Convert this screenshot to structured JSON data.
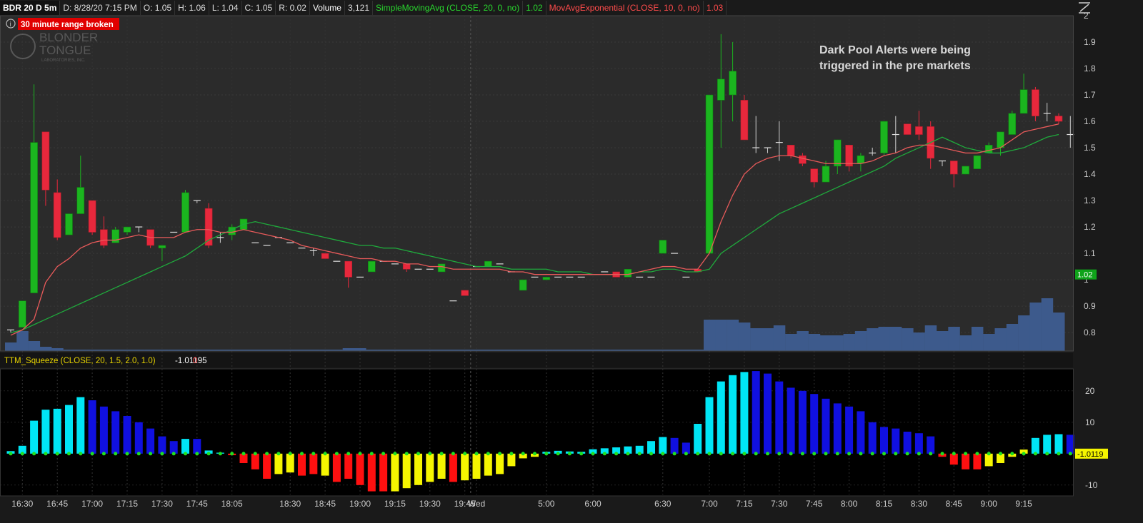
{
  "header": {
    "symbol": "BDR 20 D 5m",
    "date": "D: 8/28/20 7:15 PM",
    "open": "O: 1.05",
    "high": "H: 1.06",
    "low": "L: 1.04",
    "close": "C: 1.05",
    "range": "R: 0.02",
    "volume_label": "Volume",
    "volume_value": "3,121",
    "sma_label": "SimpleMovingAvg (CLOSE, 20, 0, no)",
    "sma_value": "1.02",
    "ema_label": "MovAvgExponential (CLOSE, 10, 0, no)",
    "ema_value": "1.03"
  },
  "alert_badge": "30 minute range broken",
  "watermark": {
    "line1": "BLONDER",
    "line2": "TONGUE",
    "line3": "LABORATORIES, INC."
  },
  "annotation": {
    "line1": "Dark Pool Alerts were being",
    "line2": "triggered in the pre markets"
  },
  "price_tag": "1.02",
  "squeeze_header": {
    "label": "TTM_Squeeze (CLOSE, 20, 1.5, 2.0, 1.0)",
    "value": "-1.01195",
    "flag": "0"
  },
  "squeeze_tag": "-1.0119",
  "icons": {
    "info": "info-icon",
    "expand": "expand-icon"
  },
  "colors": {
    "up": "#1bb51f",
    "down": "#e8283c",
    "sma": "#1faa3c",
    "ema": "#e85a5a",
    "volume": "#3d5a8c",
    "cyan": "#00e5f5",
    "blue": "#1010e0",
    "red": "#ff1010",
    "yellow": "#f5f500"
  },
  "chart_data": [
    {
      "type": "candlestick",
      "title": "",
      "ylim": [
        0.73,
        2.0
      ],
      "y_ticks": [
        0.8,
        0.9,
        1.0,
        1.1,
        1.2,
        1.3,
        1.4,
        1.5,
        1.6,
        1.7,
        1.8,
        1.9,
        2
      ],
      "y_tick_labels": [
        "0.8",
        "0.9",
        "1",
        "1.1",
        "1.2",
        "1.3",
        "1.4",
        "1.5",
        "1.6",
        "1.7",
        "1.8",
        "1.9",
        "2"
      ],
      "x_tick_labels": [
        "16:30",
        "16:45",
        "17:00",
        "17:15",
        "17:30",
        "17:45",
        "18:05",
        "18:30",
        "18:45",
        "19:00",
        "19:15",
        "19:30",
        "19:45",
        "Wed",
        "5:00",
        "6:00",
        "6:30",
        "7:00",
        "7:15",
        "7:30",
        "7:45",
        "8:00",
        "8:15",
        "8:30",
        "8:45",
        "9:00",
        "9:15"
      ],
      "candles": [
        [
          0.81,
          0.81,
          0.8,
          0.81
        ],
        [
          0.82,
          0.92,
          0.82,
          0.92
        ],
        [
          0.95,
          1.74,
          0.95,
          1.52
        ],
        [
          1.56,
          1.56,
          1.28,
          1.34
        ],
        [
          1.33,
          1.38,
          1.15,
          1.16
        ],
        [
          1.17,
          1.25,
          1.17,
          1.25
        ],
        [
          1.25,
          1.47,
          1.25,
          1.35
        ],
        [
          1.3,
          1.3,
          1.17,
          1.18
        ],
        [
          1.19,
          1.24,
          1.12,
          1.13
        ],
        [
          1.14,
          1.2,
          1.14,
          1.19
        ],
        [
          1.18,
          1.2,
          1.17,
          1.2
        ],
        [
          1.2,
          1.2,
          1.18,
          1.2
        ],
        [
          1.19,
          1.19,
          1.12,
          1.13
        ],
        [
          1.12,
          1.12,
          1.07,
          1.13
        ],
        [
          1.18,
          1.18,
          1.18,
          1.18
        ],
        [
          1.18,
          1.34,
          1.18,
          1.33
        ],
        [
          1.3,
          1.3,
          1.29,
          1.3
        ],
        [
          1.27,
          1.29,
          1.12,
          1.13
        ],
        [
          1.16,
          1.18,
          1.14,
          1.16
        ],
        [
          1.17,
          1.21,
          1.15,
          1.2
        ],
        [
          1.19,
          1.23,
          1.19,
          1.23
        ],
        [
          1.14,
          1.14,
          1.14,
          1.14
        ],
        [
          1.13,
          1.13,
          1.13,
          1.13
        ],
        [
          1.16,
          1.16,
          1.16,
          1.16
        ],
        [
          1.14,
          1.14,
          1.14,
          1.14
        ],
        [
          1.12,
          1.12,
          1.12,
          1.12
        ],
        [
          1.11,
          1.12,
          1.09,
          1.11
        ],
        [
          1.1,
          1.1,
          1.08,
          1.08
        ],
        [
          1.07,
          1.07,
          1.07,
          1.07
        ],
        [
          1.07,
          1.07,
          0.97,
          1.01
        ],
        [
          1.01,
          1.01,
          1.01,
          1.01
        ],
        [
          1.03,
          1.07,
          1.03,
          1.07
        ],
        [
          1.07,
          1.07,
          1.07,
          1.07
        ],
        [
          1.06,
          1.06,
          1.06,
          1.06
        ],
        [
          1.06,
          1.06,
          1.03,
          1.04
        ],
        [
          1.04,
          1.04,
          1.04,
          1.04
        ],
        [
          1.04,
          1.04,
          1.04,
          1.04
        ],
        [
          1.03,
          1.06,
          1.03,
          1.06
        ],
        [
          0.92,
          0.92,
          0.92,
          0.92
        ],
        [
          0.96,
          0.96,
          0.94,
          0.94
        ],
        [
          1.05,
          1.05,
          1.05,
          1.05
        ],
        [
          1.05,
          1.05,
          1.05,
          1.07
        ],
        [
          1.06,
          1.06,
          1.06,
          1.06
        ],
        [
          1.03,
          1.03,
          1.03,
          1.03
        ],
        [
          0.96,
          1.0,
          0.96,
          1.0
        ],
        [
          1.01,
          1.01,
          1.01,
          1.01
        ],
        [
          1.0,
          1.01,
          1.0,
          1.01
        ],
        [
          1.01,
          1.01,
          1.01,
          1.01
        ],
        [
          1.01,
          1.01,
          1.01,
          1.01
        ],
        [
          1.01,
          1.01,
          1.01,
          1.01
        ],
        [
          1.02,
          1.02,
          1.02,
          1.02
        ],
        [
          1.03,
          1.03,
          1.03,
          1.03
        ],
        [
          1.03,
          1.03,
          1.01,
          1.01
        ],
        [
          1.01,
          1.04,
          1.01,
          1.04
        ],
        [
          1.01,
          1.01,
          1.01,
          1.01
        ],
        [
          1.01,
          1.01,
          1.01,
          1.01
        ],
        [
          1.1,
          1.15,
          1.1,
          1.15
        ],
        [
          1.1,
          1.1,
          1.1,
          1.1
        ],
        [
          1.01,
          1.01,
          1.01,
          1.01
        ],
        [
          1.04,
          1.04,
          1.03,
          1.03
        ],
        [
          1.1,
          1.7,
          1.1,
          1.7
        ],
        [
          1.68,
          1.93,
          1.5,
          1.76
        ],
        [
          1.7,
          1.9,
          1.6,
          1.79
        ],
        [
          1.68,
          1.7,
          1.53,
          1.53
        ],
        [
          1.5,
          1.62,
          1.48,
          1.5
        ],
        [
          1.5,
          1.5,
          1.48,
          1.5
        ],
        [
          1.52,
          1.6,
          1.45,
          1.52
        ],
        [
          1.51,
          1.51,
          1.46,
          1.47
        ],
        [
          1.47,
          1.48,
          1.43,
          1.44
        ],
        [
          1.42,
          1.42,
          1.35,
          1.37
        ],
        [
          1.37,
          1.45,
          1.37,
          1.43
        ],
        [
          1.43,
          1.53,
          1.4,
          1.53
        ],
        [
          1.51,
          1.51,
          1.41,
          1.43
        ],
        [
          1.44,
          1.48,
          1.41,
          1.47
        ],
        [
          1.48,
          1.5,
          1.47,
          1.48
        ],
        [
          1.48,
          1.6,
          1.47,
          1.6
        ],
        [
          1.55,
          1.62,
          1.48,
          1.55
        ],
        [
          1.59,
          1.59,
          1.55,
          1.55
        ],
        [
          1.58,
          1.64,
          1.53,
          1.55
        ],
        [
          1.58,
          1.6,
          1.42,
          1.46
        ],
        [
          1.45,
          1.45,
          1.43,
          1.45
        ],
        [
          1.45,
          1.45,
          1.35,
          1.4
        ],
        [
          1.4,
          1.43,
          1.4,
          1.43
        ],
        [
          1.42,
          1.47,
          1.42,
          1.47
        ],
        [
          1.48,
          1.52,
          1.48,
          1.51
        ],
        [
          1.5,
          1.56,
          1.47,
          1.56
        ],
        [
          1.55,
          1.64,
          1.55,
          1.63
        ],
        [
          1.63,
          1.78,
          1.63,
          1.72
        ],
        [
          1.72,
          1.73,
          1.6,
          1.62
        ],
        [
          1.63,
          1.67,
          1.6,
          1.63
        ],
        [
          1.62,
          1.63,
          1.59,
          1.6
        ],
        [
          1.55,
          1.62,
          1.5,
          1.55
        ]
      ],
      "sma": [
        0.8,
        0.81,
        0.83,
        0.85,
        0.87,
        0.89,
        0.91,
        0.93,
        0.95,
        0.97,
        0.99,
        1.01,
        1.03,
        1.05,
        1.07,
        1.09,
        1.12,
        1.15,
        1.17,
        1.19,
        1.21,
        1.22,
        1.21,
        1.2,
        1.19,
        1.18,
        1.17,
        1.16,
        1.15,
        1.14,
        1.13,
        1.13,
        1.12,
        1.12,
        1.11,
        1.1,
        1.09,
        1.08,
        1.07,
        1.06,
        1.05,
        1.05,
        1.05,
        1.04,
        1.04,
        1.04,
        1.04,
        1.03,
        1.03,
        1.03,
        1.02,
        1.02,
        1.02,
        1.02,
        1.03,
        1.03,
        1.04,
        1.04,
        1.03,
        1.03,
        1.04,
        1.1,
        1.13,
        1.16,
        1.19,
        1.22,
        1.25,
        1.27,
        1.29,
        1.31,
        1.33,
        1.35,
        1.37,
        1.39,
        1.41,
        1.43,
        1.46,
        1.48,
        1.5,
        1.52,
        1.54,
        1.52,
        1.5,
        1.49,
        1.48,
        1.48,
        1.49,
        1.5,
        1.52,
        1.54,
        1.55
      ],
      "ema": [
        0.79,
        0.81,
        0.85,
        0.99,
        1.05,
        1.08,
        1.12,
        1.14,
        1.15,
        1.15,
        1.16,
        1.17,
        1.16,
        1.16,
        1.16,
        1.18,
        1.19,
        1.19,
        1.18,
        1.18,
        1.19,
        1.18,
        1.17,
        1.16,
        1.15,
        1.13,
        1.12,
        1.11,
        1.1,
        1.09,
        1.08,
        1.08,
        1.07,
        1.07,
        1.06,
        1.06,
        1.05,
        1.05,
        1.04,
        1.04,
        1.04,
        1.04,
        1.04,
        1.03,
        1.03,
        1.02,
        1.02,
        1.02,
        1.02,
        1.02,
        1.02,
        1.02,
        1.02,
        1.02,
        1.03,
        1.04,
        1.05,
        1.05,
        1.04,
        1.04,
        1.1,
        1.22,
        1.32,
        1.4,
        1.44,
        1.46,
        1.47,
        1.47,
        1.46,
        1.45,
        1.44,
        1.44,
        1.44,
        1.44,
        1.45,
        1.47,
        1.48,
        1.5,
        1.51,
        1.51,
        1.5,
        1.49,
        1.48,
        1.48,
        1.49,
        1.5,
        1.53,
        1.56,
        1.57,
        1.58,
        1.59
      ],
      "volume": [
        0.06,
        0.14,
        0.07,
        0.03,
        0.02,
        0.01,
        0.01,
        0.01,
        0.01,
        0.01,
        0.01,
        0.01,
        0.01,
        0.01,
        0.01,
        0.01,
        0.01,
        0.01,
        0.01,
        0.01,
        0.01,
        0.01,
        0.01,
        0.01,
        0.01,
        0.01,
        0.01,
        0.01,
        0.01,
        0.02,
        0.02,
        0.01,
        0.01,
        0.01,
        0.01,
        0.01,
        0.01,
        0.01,
        0.01,
        0.01,
        0.01,
        0.01,
        0.01,
        0.01,
        0.01,
        0.01,
        0.01,
        0.01,
        0.01,
        0.01,
        0.01,
        0.01,
        0.01,
        0.01,
        0.01,
        0.01,
        0.01,
        0.01,
        0.01,
        0.01,
        0.22,
        0.22,
        0.22,
        0.2,
        0.16,
        0.16,
        0.18,
        0.12,
        0.14,
        0.12,
        0.11,
        0.11,
        0.12,
        0.14,
        0.16,
        0.17,
        0.17,
        0.16,
        0.13,
        0.18,
        0.14,
        0.17,
        0.11,
        0.17,
        0.12,
        0.16,
        0.19,
        0.25,
        0.34,
        0.37,
        0.27
      ]
    },
    {
      "type": "bar",
      "title": "",
      "ylim": [
        -13,
        27
      ],
      "y_ticks": [
        20,
        10,
        -10
      ],
      "y_tick_labels": [
        "20",
        "10",
        "-10"
      ],
      "values": [
        0.8,
        2.5,
        10.5,
        14,
        14.3,
        15.5,
        18,
        17,
        15,
        13.5,
        12,
        10,
        8,
        5.5,
        4,
        4.7,
        4.7,
        1,
        0.3,
        -0.5,
        -3,
        -5,
        -8,
        -6.5,
        -6,
        -7,
        -6.5,
        -7,
        -9,
        -8,
        -10,
        -12,
        -12,
        -12,
        -11,
        -10,
        -9,
        -8,
        -9,
        -8.5,
        -8,
        -7,
        -6.5,
        -4,
        -1.5,
        -1,
        0.6,
        0.9,
        0.7,
        0.6,
        1.4,
        1.7,
        2,
        2.3,
        2.5,
        4,
        5.3,
        5,
        3.5,
        9.5,
        18,
        23,
        25,
        26,
        26.3,
        25.5,
        23,
        21,
        20,
        19,
        17.5,
        16,
        15,
        13.5,
        10,
        8.5,
        8,
        7,
        6.5,
        5.5,
        -1,
        -3.5,
        -5,
        -5,
        -4,
        -3,
        -1,
        1.3,
        5,
        6,
        6.2,
        6
      ],
      "colors": [
        "cyan",
        "cyan",
        "cyan",
        "cyan",
        "cyan",
        "cyan",
        "cyan",
        "blue",
        "blue",
        "blue",
        "blue",
        "blue",
        "blue",
        "blue",
        "blue",
        "cyan",
        "blue",
        "cyan",
        "cyan",
        "red",
        "red",
        "red",
        "red",
        "yellow",
        "yellow",
        "red",
        "red",
        "yellow",
        "red",
        "red",
        "red",
        "red",
        "red",
        "yellow",
        "yellow",
        "yellow",
        "yellow",
        "yellow",
        "red",
        "yellow",
        "yellow",
        "yellow",
        "yellow",
        "yellow",
        "yellow",
        "yellow",
        "cyan",
        "cyan",
        "cyan",
        "cyan",
        "cyan",
        "cyan",
        "cyan",
        "cyan",
        "cyan",
        "cyan",
        "cyan",
        "blue",
        "blue",
        "cyan",
        "cyan",
        "cyan",
        "cyan",
        "cyan",
        "blue",
        "blue",
        "blue",
        "blue",
        "blue",
        "blue",
        "blue",
        "blue",
        "blue",
        "blue",
        "blue",
        "blue",
        "blue",
        "blue",
        "blue",
        "blue",
        "red",
        "red",
        "red",
        "red",
        "yellow",
        "yellow",
        "yellow",
        "yellow",
        "cyan",
        "cyan",
        "cyan",
        "blue"
      ]
    }
  ]
}
